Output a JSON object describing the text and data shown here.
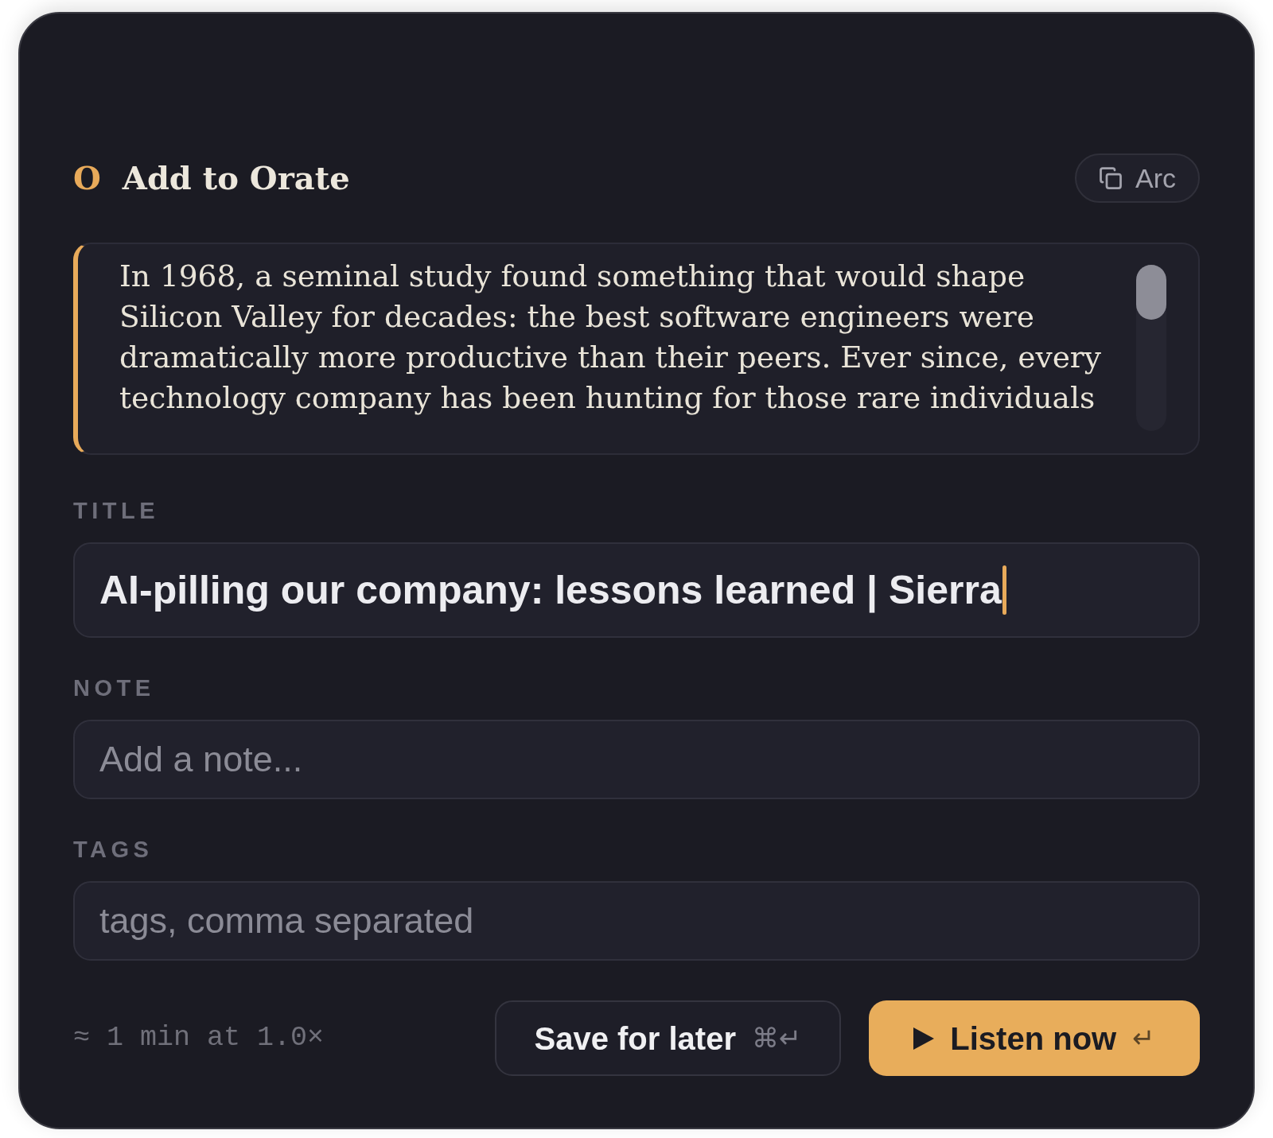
{
  "header": {
    "logo": "O",
    "title": "Add to Orate",
    "source_button": {
      "label": "Arc"
    }
  },
  "excerpt": {
    "text": "In 1968, a seminal study found something that would shape Silicon Valley for decades: the best software engineers were dramatically more productive than their peers. Ever since, every technology company has been hunting for those rare individuals"
  },
  "fields": [
    {
      "kind": "title",
      "label": "TITLE",
      "value": "AI-pilling our company: lessons learned | Sierra",
      "focused": true
    },
    {
      "kind": "plain",
      "label": "NOTE",
      "placeholder": "Add a note..."
    },
    {
      "kind": "plain",
      "label": "TAGS",
      "placeholder": "tags, comma separated"
    }
  ],
  "footer": {
    "estimate": "≈ 1 min at 1.0×",
    "buttons": [
      {
        "kind": "secondary",
        "label": "Save for later",
        "shortcut": "⌘↵"
      },
      {
        "kind": "primary",
        "label": "Listen now",
        "shortcut": "↵"
      }
    ]
  }
}
